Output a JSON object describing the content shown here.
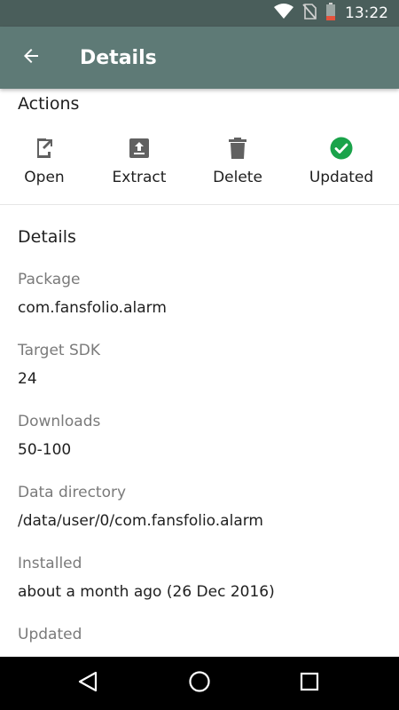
{
  "status_bar": {
    "time": "13:22",
    "icons": [
      "wifi-icon",
      "no-sim-icon",
      "battery-low-icon"
    ]
  },
  "app_bar": {
    "title": "Details",
    "back_icon": "arrow-left-icon"
  },
  "actions": {
    "title": "Actions",
    "items": [
      {
        "label": "Open",
        "icon": "open-external-icon"
      },
      {
        "label": "Extract",
        "icon": "upload-box-icon"
      },
      {
        "label": "Delete",
        "icon": "trash-icon"
      },
      {
        "label": "Updated",
        "icon": "check-circle-icon"
      }
    ]
  },
  "details": {
    "title": "Details",
    "items": [
      {
        "key": "Package",
        "value": "com.fansfolio.alarm"
      },
      {
        "key": "Target SDK",
        "value": "24"
      },
      {
        "key": "Downloads",
        "value": "50-100"
      },
      {
        "key": "Data directory",
        "value": "/data/user/0/com.fansfolio.alarm"
      },
      {
        "key": "Installed",
        "value": "about a month ago (26 Dec 2016)"
      },
      {
        "key": "Updated",
        "value": ""
      }
    ]
  },
  "nav_bar": {
    "icons": [
      "back-triangle-icon",
      "home-circle-icon",
      "recents-square-icon"
    ]
  },
  "colors": {
    "status_bar": "#4a5e5b",
    "app_bar": "#5e7a76",
    "updated_green": "#1aa34a",
    "icon_gray": "#616161"
  }
}
